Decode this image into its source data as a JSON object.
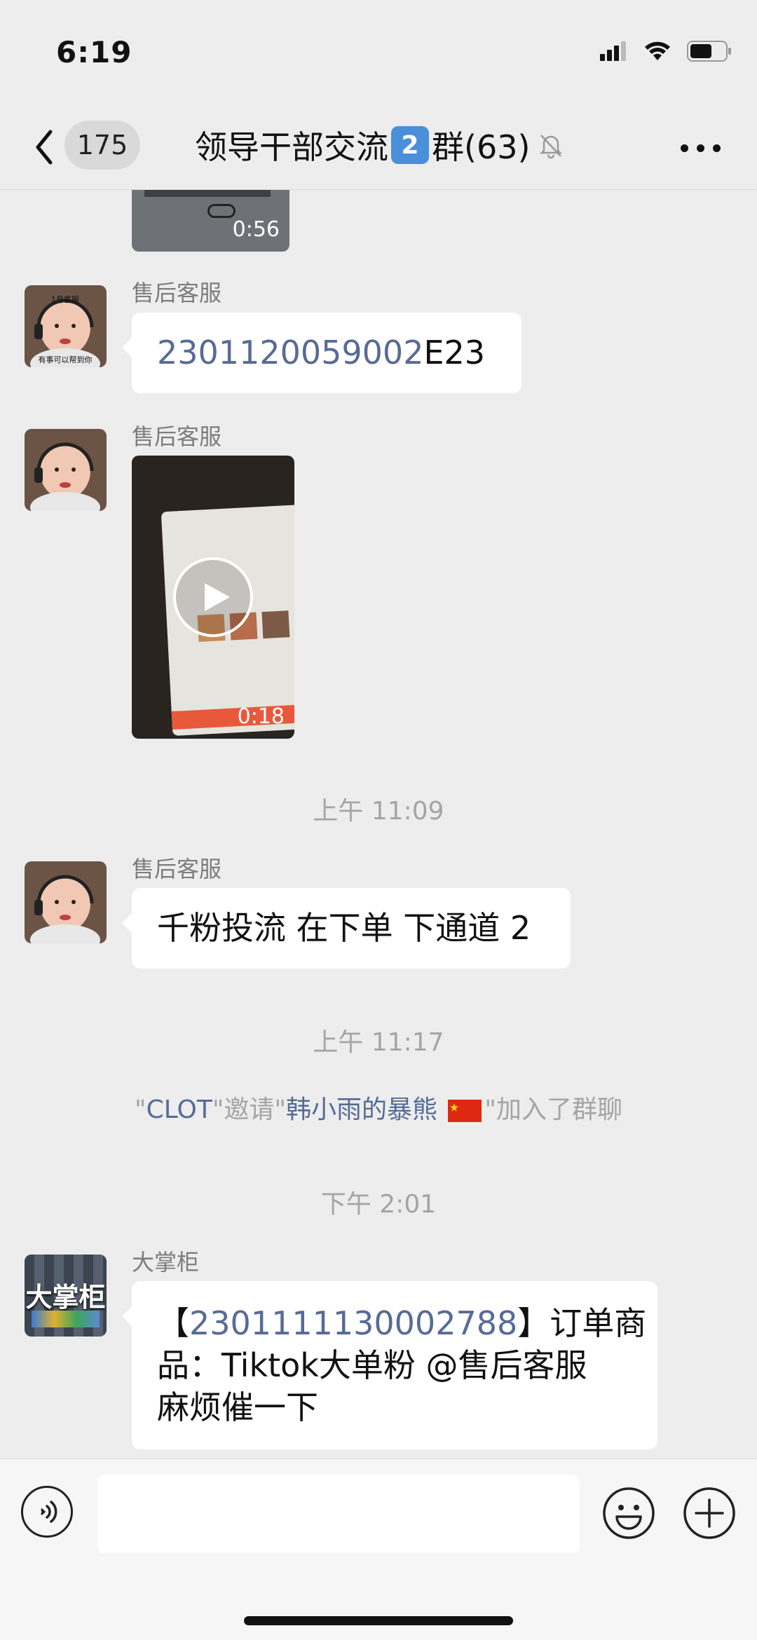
{
  "status_bar": {
    "time": "6:19"
  },
  "nav": {
    "unread_count": "175",
    "title_prefix": "领导干部交流",
    "title_number": "2",
    "title_suffix": "群(63)"
  },
  "messages": [
    {
      "type": "video",
      "duration": "0:56"
    },
    {
      "type": "text",
      "sender": "售后客服",
      "link": "2301120059002",
      "text": "E23"
    },
    {
      "type": "video",
      "sender": "售后客服",
      "duration": "0:18"
    },
    {
      "type": "timestamp",
      "text": "上午 11:09"
    },
    {
      "type": "text",
      "sender": "售后客服",
      "text": "千粉投流 在下单 下通道 2"
    },
    {
      "type": "timestamp",
      "text": "上午 11:17"
    },
    {
      "type": "system",
      "q1": "\"",
      "inviter": "CLOT",
      "q2": "\"邀请\"",
      "invitee": "韩小雨的暴熊",
      "q3": "\"加入了群聊"
    },
    {
      "type": "timestamp",
      "text": "下午 2:01"
    },
    {
      "type": "text",
      "sender": "大掌柜",
      "avatar_text": "大掌柜",
      "open_bracket": "【",
      "link": "2301111130002788",
      "line1_rest": "】订单商",
      "line2": "品：Tiktok大单粉 @售后客服",
      "line3": "麻烦催一下"
    }
  ],
  "avatar_badge": {
    "top": "1号客服",
    "bottom": "有事可以帮到你"
  },
  "input_bar": {
    "placeholder": ""
  },
  "colors": {
    "link": "#576b95",
    "background": "#ededed",
    "bubble": "#ffffff",
    "timestamp": "#a5a5a5"
  }
}
